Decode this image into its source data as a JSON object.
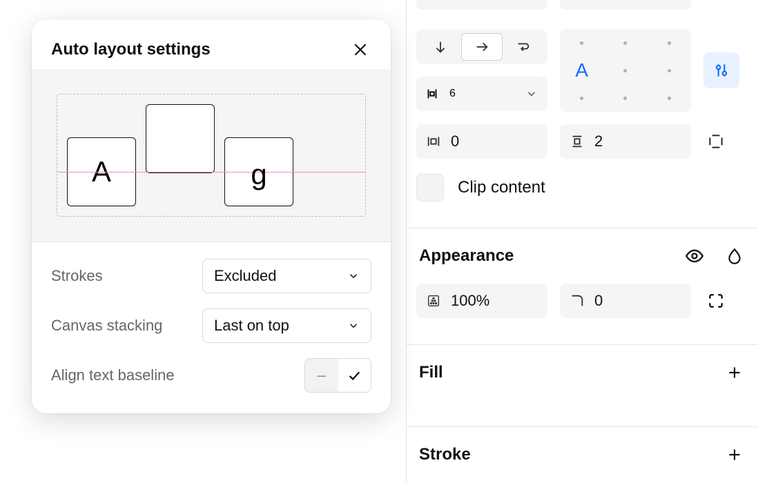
{
  "modal": {
    "title": "Auto layout settings",
    "preview_letters": {
      "a": "A",
      "g": "g"
    },
    "fields": {
      "strokes": {
        "label": "Strokes",
        "value": "Excluded"
      },
      "canvas_stacking": {
        "label": "Canvas stacking",
        "value": "Last on top"
      },
      "align_baseline": {
        "label": "Align text baseline",
        "off_glyph": "–"
      }
    }
  },
  "panel": {
    "align_letter": "A",
    "gap_value": "6",
    "padding_h": "0",
    "padding_v": "2",
    "clip_label": "Clip content",
    "appearance": {
      "title": "Appearance",
      "opacity": "100%",
      "corner": "0"
    },
    "fill": {
      "title": "Fill"
    },
    "stroke": {
      "title": "Stroke"
    }
  }
}
